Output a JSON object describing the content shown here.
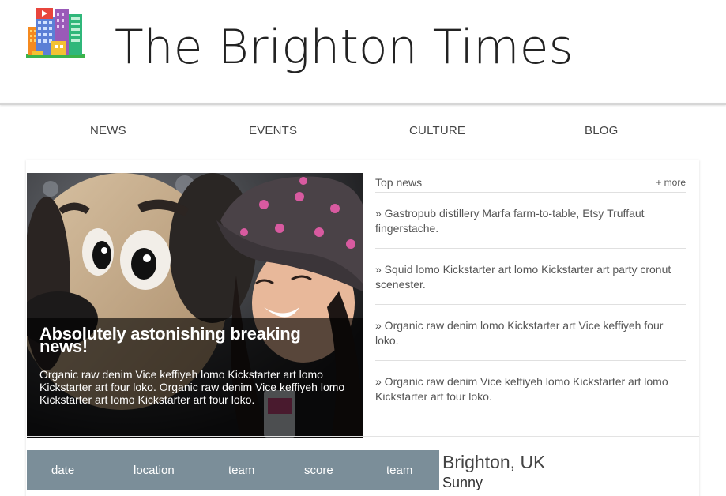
{
  "site": {
    "title": "The Brighton Times"
  },
  "nav": {
    "items": [
      "NEWS",
      "EVENTS",
      "CULTURE",
      "BLOG"
    ]
  },
  "feature": {
    "headline": "Absolutely astonishing breaking news!",
    "summary": "Organic raw denim Vice keffiyeh lomo Kickstarter art lomo Kickstarter art four loko. Organic raw denim Vice keffiyeh lomo Kickstarter art lomo Kickstarter art four loko."
  },
  "top_news": {
    "title": "Top news",
    "more_label": "+ more",
    "items": [
      "» Gastropub distillery Marfa farm-to-table, Etsy Truffaut fingerstache.",
      "» Squid lomo Kickstarter art lomo Kickstarter art party cronut scenester.",
      "» Organic raw denim lomo Kickstarter art Vice keffiyeh four loko.",
      "» Organic raw denim Vice keffiyeh lomo Kickstarter art lomo Kickstarter art four loko."
    ]
  },
  "score_table": {
    "columns": [
      "date",
      "location",
      "team",
      "score",
      "team"
    ]
  },
  "weather": {
    "location": "Brighton, UK",
    "condition": "Sunny"
  },
  "colors": {
    "score_bar": "#7b8e99",
    "overlay": "rgba(0,0,0,0.62)",
    "rule": "#d6d6d6"
  },
  "icons": {
    "logo": "city-buildings-logo-icon"
  }
}
